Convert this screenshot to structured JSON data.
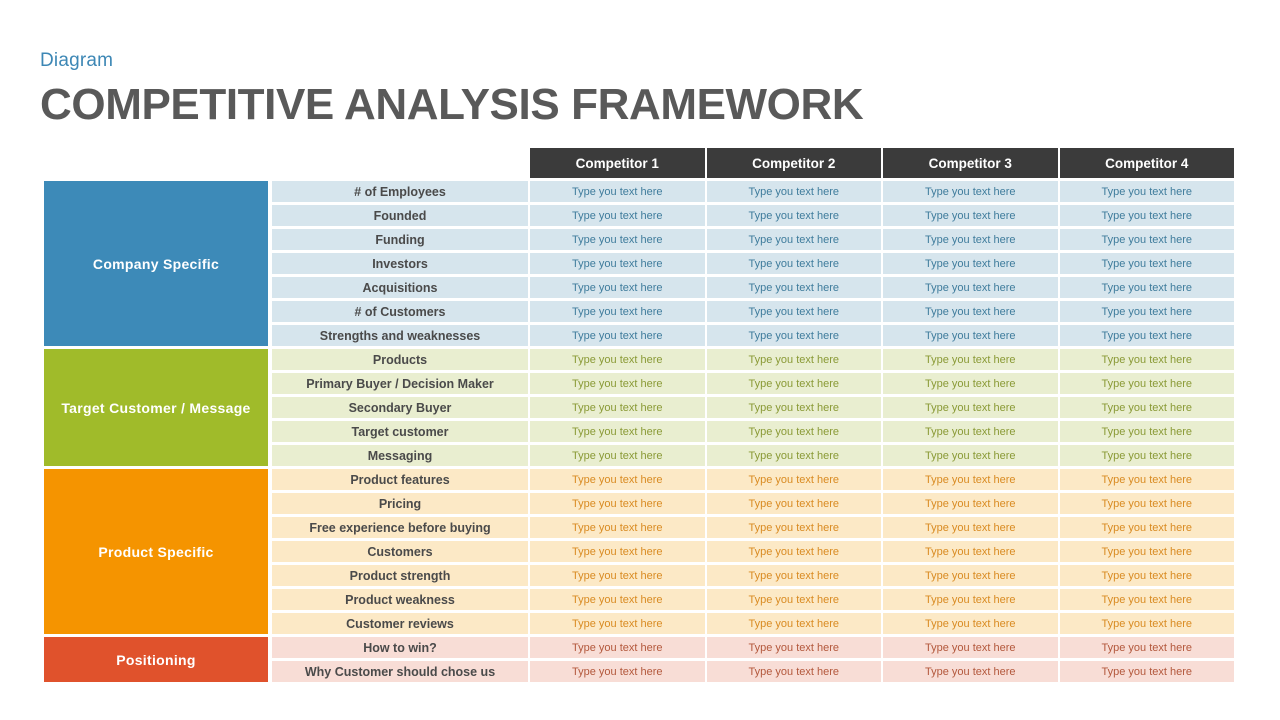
{
  "header": {
    "kicker": "Diagram",
    "title": "COMPETITIVE ANALYSIS FRAMEWORK"
  },
  "table": {
    "placeholder": "Type you text here",
    "columns": [
      {
        "label": "Competitor 1"
      },
      {
        "label": "Competitor 2"
      },
      {
        "label": "Competitor 3"
      },
      {
        "label": "Competitor 4"
      }
    ],
    "colors": {
      "company_specific": "#3d8ab8",
      "target_customer": "#a0bb2a",
      "product_specific": "#f59400",
      "positioning": "#e0522c",
      "header": "#3b3b3b",
      "company_specific_tint": "#d6e5ed",
      "target_customer_tint": "#e9eed0",
      "product_specific_tint": "#fce9c6",
      "positioning_tint": "#f8ddd6"
    },
    "sections": [
      {
        "category": "Company Specific",
        "theme": "blue",
        "rows": [
          "# of Employees",
          "Founded",
          "Funding",
          "Investors",
          "Acquisitions",
          "# of Customers",
          "Strengths and weaknesses"
        ]
      },
      {
        "category": "Target Customer  /  Message",
        "theme": "green",
        "rows": [
          "Products",
          "Primary Buyer / Decision Maker",
          "Secondary Buyer",
          "Target customer",
          "Messaging"
        ]
      },
      {
        "category": "Product Specific",
        "theme": "orange",
        "rows": [
          "Product features",
          "Pricing",
          "Free experience before buying",
          "Customers",
          "Product strength",
          "Product weakness",
          "Customer reviews"
        ]
      },
      {
        "category": "Positioning",
        "theme": "red",
        "rows": [
          "How to win?",
          "Why Customer should chose us"
        ]
      }
    ]
  }
}
